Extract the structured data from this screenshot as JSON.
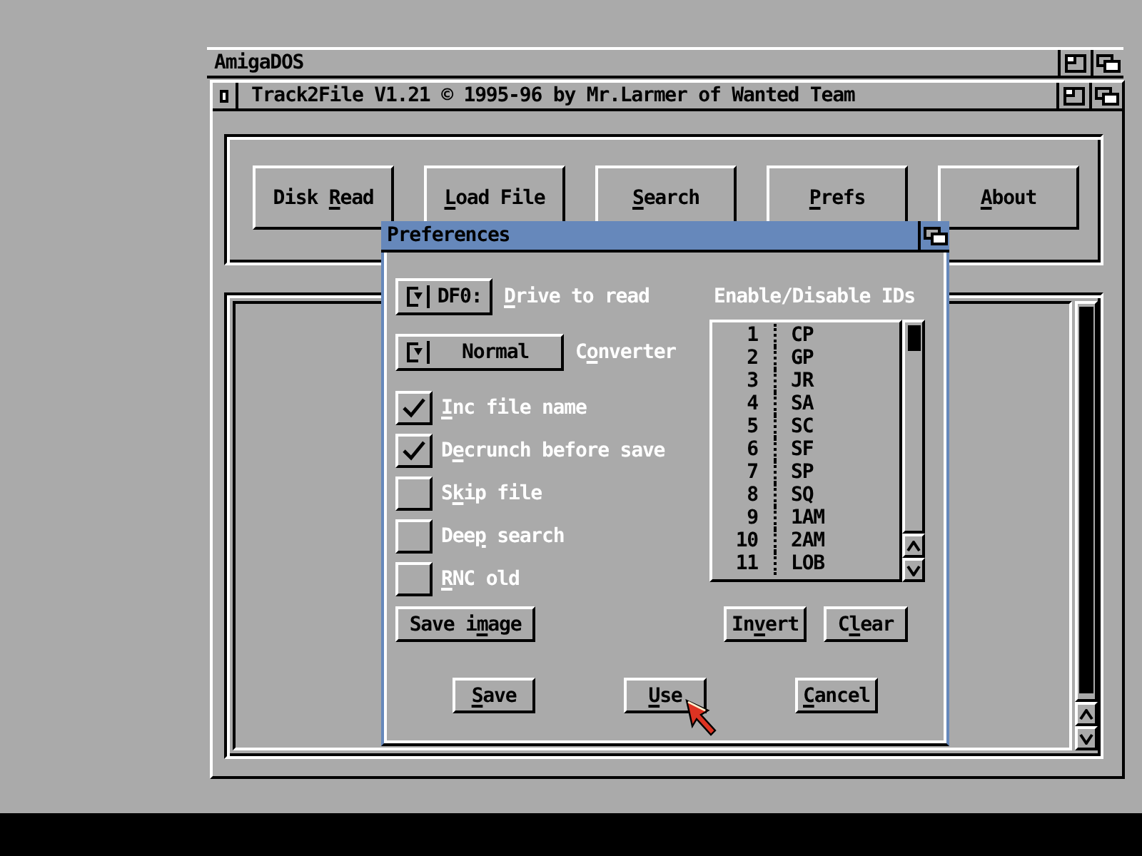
{
  "screen": {
    "title": "AmigaDOS"
  },
  "window": {
    "title": "Track2File V1.21 © 1995-96 by Mr.Larmer of Wanted Team",
    "buttons": [
      {
        "label": [
          {
            "text": "Disk ",
            "underlined": false
          },
          {
            "text": "R",
            "underlined": true
          },
          {
            "text": "ead",
            "underlined": false
          }
        ]
      },
      {
        "label": [
          {
            "text": "L",
            "underlined": true
          },
          {
            "text": "oad File",
            "underlined": false
          }
        ]
      },
      {
        "label": [
          {
            "text": "S",
            "underlined": true
          },
          {
            "text": "earch",
            "underlined": false
          }
        ]
      },
      {
        "label": [
          {
            "text": "P",
            "underlined": true
          },
          {
            "text": "refs",
            "underlined": false
          }
        ]
      },
      {
        "label": [
          {
            "text": "A",
            "underlined": true
          },
          {
            "text": "bout",
            "underlined": false
          }
        ]
      }
    ]
  },
  "dialog": {
    "title": "Preferences",
    "cycles": [
      {
        "value": "DF0:",
        "label": [
          {
            "text": "D",
            "underlined": true
          },
          {
            "text": "rive to read",
            "underlined": false
          }
        ]
      },
      {
        "value": "Normal",
        "label": [
          {
            "text": "C",
            "underlined": false
          },
          {
            "text": "o",
            "underlined": true
          },
          {
            "text": "nverter",
            "underlined": false
          }
        ]
      }
    ],
    "options": [
      {
        "label": [
          {
            "text": "I",
            "underlined": true
          },
          {
            "text": "nc file name",
            "underlined": false
          }
        ],
        "checked": true
      },
      {
        "label": [
          {
            "text": "D",
            "underlined": false
          },
          {
            "text": "e",
            "underlined": true
          },
          {
            "text": "crunch before save",
            "underlined": false
          }
        ],
        "checked": true
      },
      {
        "label": [
          {
            "text": "S",
            "underlined": false
          },
          {
            "text": "k",
            "underlined": true
          },
          {
            "text": "ip file",
            "underlined": false
          }
        ],
        "checked": false
      },
      {
        "label": [
          {
            "text": "Dee",
            "underlined": false
          },
          {
            "text": "p",
            "underlined": true
          },
          {
            "text": " search",
            "underlined": false
          }
        ],
        "checked": false
      },
      {
        "label": [
          {
            "text": "R",
            "underlined": true
          },
          {
            "text": "NC old",
            "underlined": false
          }
        ],
        "checked": false
      }
    ],
    "list_title": "Enable/Disable IDs",
    "ids": [
      {
        "number": "1",
        "name": "CP"
      },
      {
        "number": "2",
        "name": "GP"
      },
      {
        "number": "3",
        "name": "JR"
      },
      {
        "number": "4",
        "name": "SA"
      },
      {
        "number": "5",
        "name": "SC"
      },
      {
        "number": "6",
        "name": "SF"
      },
      {
        "number": "7",
        "name": "SP"
      },
      {
        "number": "8",
        "name": "SQ"
      },
      {
        "number": "9",
        "name": "1AM"
      },
      {
        "number": "10",
        "name": "2AM"
      },
      {
        "number": "11",
        "name": "LOB"
      }
    ],
    "save_image_button": {
      "label": [
        {
          "text": "Save i",
          "underlined": false
        },
        {
          "text": "m",
          "underlined": true
        },
        {
          "text": "age",
          "underlined": false
        }
      ]
    },
    "list_buttons": [
      {
        "label": [
          {
            "text": "In",
            "underlined": false
          },
          {
            "text": "v",
            "underlined": true
          },
          {
            "text": "ert",
            "underlined": false
          }
        ]
      },
      {
        "label": [
          {
            "text": "C",
            "underlined": false
          },
          {
            "text": "l",
            "underlined": true
          },
          {
            "text": "ear",
            "underlined": false
          }
        ]
      }
    ],
    "buttons": [
      {
        "label": [
          {
            "text": "S",
            "underlined": true
          },
          {
            "text": "ave",
            "underlined": false
          }
        ]
      },
      {
        "label": [
          {
            "text": "U",
            "underlined": true
          },
          {
            "text": "se",
            "underlined": false
          }
        ]
      },
      {
        "label": [
          {
            "text": "C",
            "underlined": true
          },
          {
            "text": "ancel",
            "underlined": false
          }
        ]
      }
    ]
  }
}
